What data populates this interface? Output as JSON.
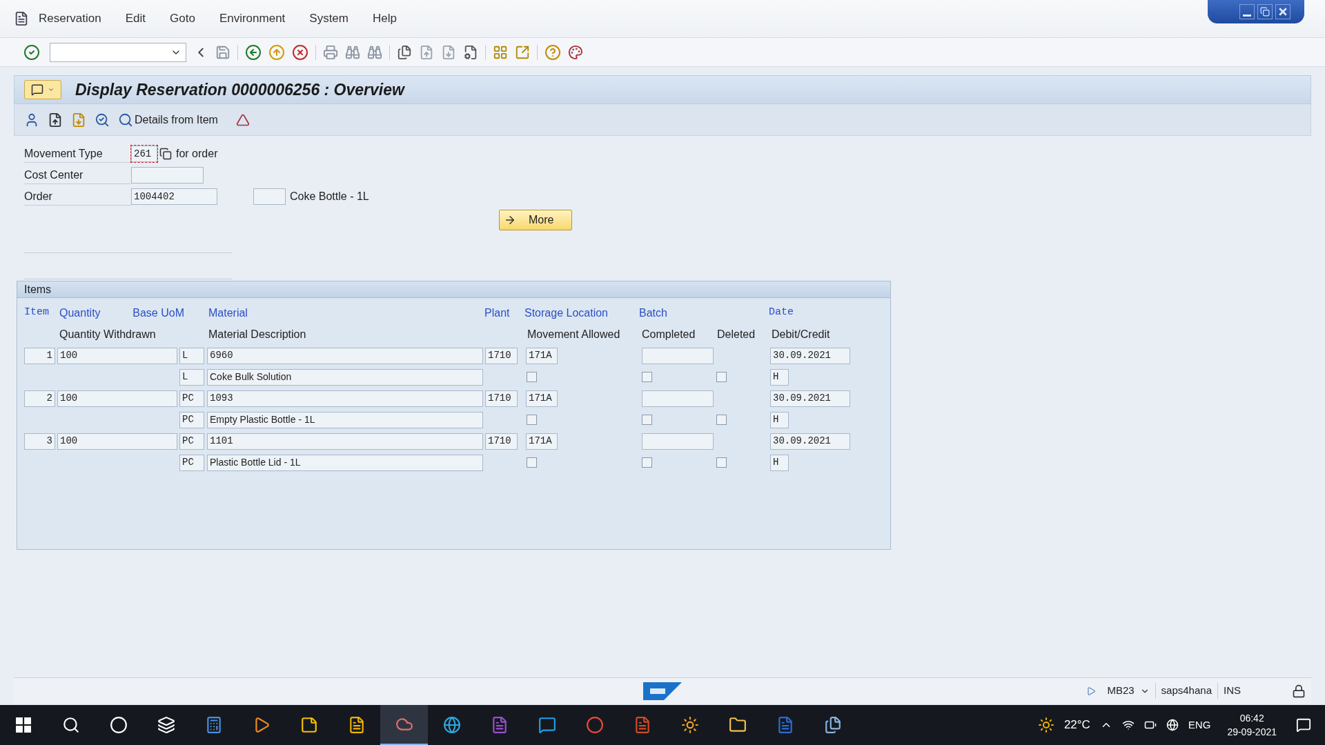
{
  "menu_bar": [
    "Reservation",
    "Edit",
    "Goto",
    "Environment",
    "System",
    "Help"
  ],
  "screen_title": "Display Reservation 0000006256 : Overview",
  "app_toolbar": {
    "details_button": "Details from Item"
  },
  "header_form": {
    "movement_type": {
      "label": "Movement Type",
      "value": "261",
      "focused": true,
      "suffix": "for order"
    },
    "cost_center": {
      "label": "Cost Center"
    },
    "order": {
      "label": "Order",
      "value": "1004402",
      "description": "Coke Bottle - 1L"
    },
    "more_button": "More"
  },
  "items": {
    "title": "Items",
    "columns_top": [
      "Item",
      "Quantity",
      "Base UoM",
      "Material",
      "Plant",
      "Storage Location",
      "Batch",
      "Date"
    ],
    "columns_bottom": [
      "Quantity Withdrawn",
      "Material Description",
      "Movement Allowed",
      "Completed",
      "Deleted",
      "Debit/Credit"
    ],
    "rows": [
      {
        "item": "1",
        "quantity": "100",
        "uom": "L",
        "material": "6960",
        "plant": "1710",
        "storage_location": "171A",
        "date": "30.09.2021",
        "uom_2": "L",
        "description": "Coke Bulk Solution",
        "movement_allowed": false,
        "completed": false,
        "deleted": false,
        "debit_credit": "H"
      },
      {
        "item": "2",
        "quantity": "100",
        "uom": "PC",
        "material": "1093",
        "plant": "1710",
        "storage_location": "171A",
        "date": "30.09.2021",
        "uom_2": "PC",
        "description": "Empty Plastic Bottle - 1L",
        "movement_allowed": false,
        "completed": false,
        "deleted": false,
        "debit_credit": "H"
      },
      {
        "item": "3",
        "quantity": "100",
        "uom": "PC",
        "material": "1101",
        "plant": "1710",
        "storage_location": "171A",
        "date": "30.09.2021",
        "uom_2": "PC",
        "description": "Plastic Bottle Lid - 1L",
        "movement_allowed": false,
        "completed": false,
        "deleted": false,
        "debit_credit": "H"
      }
    ]
  },
  "status_bar": {
    "transaction": "MB23",
    "server": "saps4hana",
    "mode": "INS"
  },
  "taskbar": {
    "weather": "22°C",
    "language": "ENG",
    "time": "06:42",
    "date": "29-09-2021"
  }
}
